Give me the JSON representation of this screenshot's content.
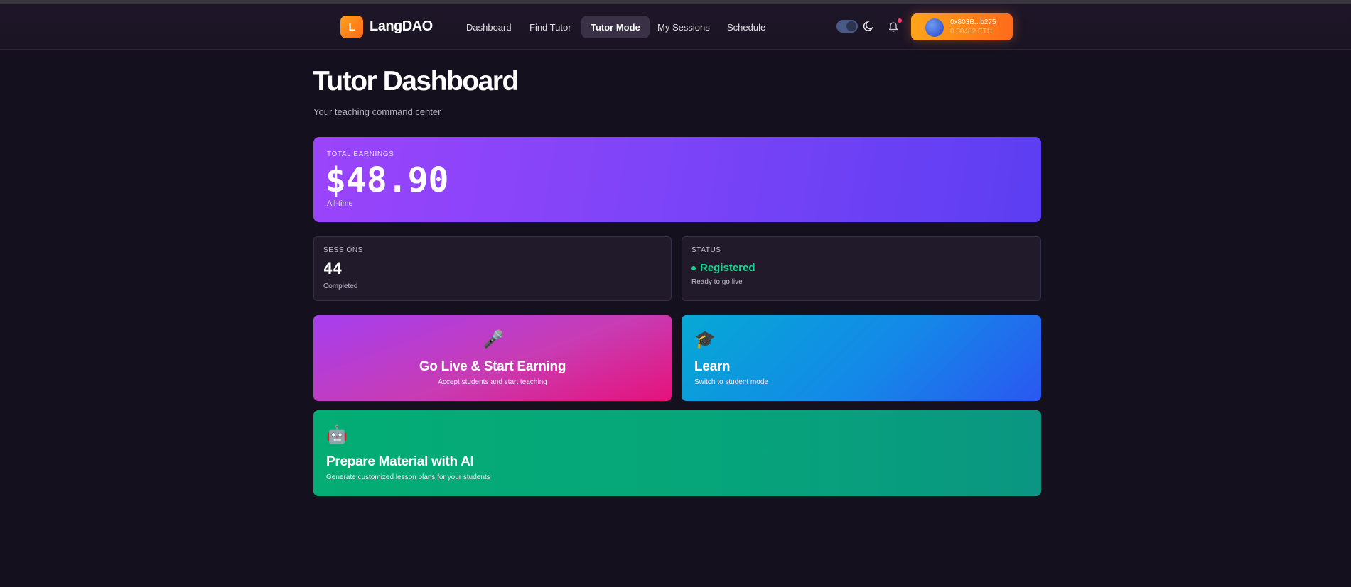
{
  "nav": {
    "logo_letter": "L",
    "brand": "LangDAO",
    "items": [
      {
        "label": "Dashboard"
      },
      {
        "label": "Find Tutor"
      },
      {
        "label": "Tutor Mode"
      },
      {
        "label": "My Sessions"
      },
      {
        "label": "Schedule"
      }
    ],
    "active_index": 2,
    "wallet": {
      "address": "0x803B...b275",
      "balance": "0.00482 ETH"
    },
    "icons": [
      "theme-toggle",
      "moon-icon",
      "bell-icon"
    ]
  },
  "page": {
    "title": "Tutor Dashboard",
    "subtitle": "Your teaching command center"
  },
  "earnings": {
    "label": "TOTAL EARNINGS",
    "value": "$48.90",
    "sub": "All-time"
  },
  "sessions": {
    "label": "SESSIONS",
    "value": "44",
    "sub": "Completed"
  },
  "status": {
    "label": "STATUS",
    "value": "Registered",
    "sub": "Ready to go live"
  },
  "actions": {
    "golive": {
      "icon": "🎤",
      "title": "Go Live & Start Earning",
      "sub": "Accept students and start teaching"
    },
    "learn": {
      "icon": "🎓",
      "title": "Learn",
      "sub": "Switch to student mode"
    },
    "ai": {
      "icon": "🤖",
      "title": "Prepare Material with AI",
      "sub": "Generate customized lesson plans for your students"
    }
  },
  "colors": {
    "background": "#15101d",
    "accent_orange": "#ff8a1a",
    "earnings_purple": "#7f44f8",
    "status_green": "#19d48f",
    "golive_pink": "#e6127a",
    "learn_blue": "#1488e8",
    "ai_green": "#06a57a"
  }
}
